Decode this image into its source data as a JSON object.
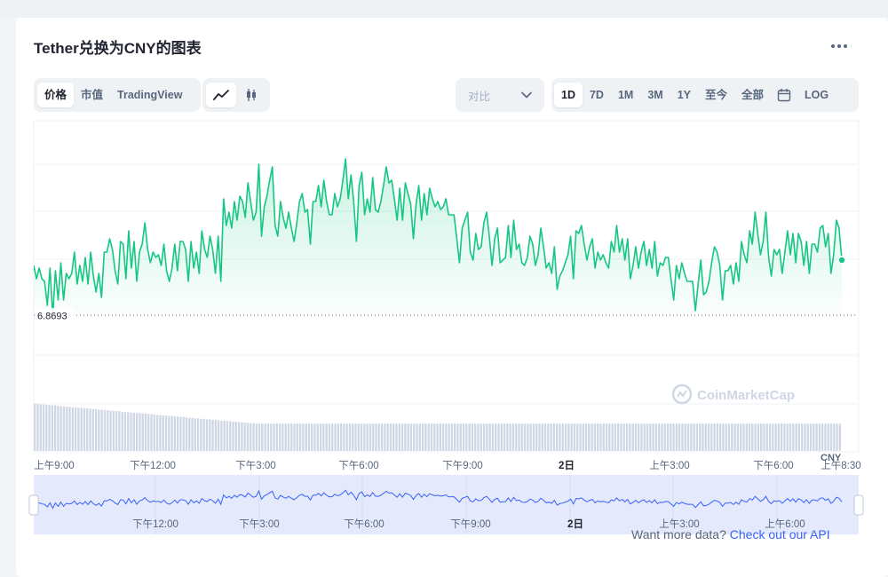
{
  "title": "Tether兑换为CNY的图表",
  "view_tabs": [
    "价格",
    "市值",
    "TradingView"
  ],
  "active_view": "价格",
  "chart_style_icons": [
    "line-chart-icon",
    "candlestick-icon"
  ],
  "compare": {
    "label": "对比",
    "icon": "chevron-down-icon"
  },
  "range_tabs": [
    "1D",
    "7D",
    "1M",
    "3M",
    "1Y",
    "至今",
    "全部"
  ],
  "active_range": "1D",
  "calendar_icon": "calendar-icon",
  "log_label": "LOG",
  "price_label": "6.8693",
  "currency_label": "CNY",
  "watermark": "CoinMarketCap",
  "x_ticks": [
    "上午9:00",
    "下午12:00",
    "下午3:00",
    "下午6:00",
    "下午9:00",
    "2日",
    "上午3:00",
    "下午6:00",
    "上午8:30"
  ],
  "mini_ticks": [
    "下午12:00",
    "下午3:00",
    "下午6:00",
    "下午9:00",
    "2日",
    "上午3:00",
    "上午6:00"
  ],
  "api_text": "Want more data?",
  "api_link": "Check out our API",
  "colors": {
    "up": "#16c784",
    "down": "#ea3943",
    "brand": "#3861fb",
    "navigator": "#3861fb"
  },
  "chart_data": {
    "type": "line",
    "baseline": 6.8693,
    "ylim": [
      6.862,
      6.896
    ],
    "grid": true,
    "price_shape": [
      0.47,
      0.42,
      0.46,
      0.42,
      0.41,
      0.32,
      0.46,
      0.28,
      0.45,
      0.34,
      0.48,
      0.34,
      0.44,
      0.42,
      0.44,
      0.52,
      0.4,
      0.47,
      0.41,
      0.5,
      0.4,
      0.52,
      0.43,
      0.37,
      0.44,
      0.35,
      0.52,
      0.52,
      0.57,
      0.53,
      0.45,
      0.4,
      0.56,
      0.55,
      0.42,
      0.6,
      0.46,
      0.56,
      0.41,
      0.52,
      0.55,
      0.63,
      0.53,
      0.48,
      0.52,
      0.5,
      0.51,
      0.47,
      0.55,
      0.45,
      0.41,
      0.46,
      0.55,
      0.45,
      0.56,
      0.56,
      0.53,
      0.41,
      0.56,
      0.46,
      0.52,
      0.44,
      0.6,
      0.53,
      0.5,
      0.58,
      0.53,
      0.44,
      0.58,
      0.41,
      0.72,
      0.62,
      0.67,
      0.61,
      0.71,
      0.64,
      0.73,
      0.71,
      0.65,
      0.78,
      0.71,
      0.64,
      0.67,
      0.85,
      0.58,
      0.69,
      0.73,
      0.79,
      0.84,
      0.62,
      0.58,
      0.71,
      0.65,
      0.61,
      0.67,
      0.61,
      0.56,
      0.63,
      0.71,
      0.74,
      0.67,
      0.68,
      0.55,
      0.71,
      0.71,
      0.77,
      0.69,
      0.79,
      0.71,
      0.66,
      0.66,
      0.74,
      0.69,
      0.72,
      0.79,
      0.87,
      0.72,
      0.81,
      0.71,
      0.56,
      0.77,
      0.82,
      0.66,
      0.72,
      0.67,
      0.8,
      0.68,
      0.67,
      0.71,
      0.77,
      0.84,
      0.78,
      0.79,
      0.72,
      0.64,
      0.76,
      0.64,
      0.78,
      0.74,
      0.7,
      0.57,
      0.7,
      0.77,
      0.64,
      0.74,
      0.66,
      0.76,
      0.72,
      0.69,
      0.71,
      0.68,
      0.69,
      0.72,
      0.66,
      0.66,
      0.66,
      0.57,
      0.48,
      0.61,
      0.64,
      0.67,
      0.52,
      0.49,
      0.59,
      0.53,
      0.54,
      0.63,
      0.67,
      0.58,
      0.47,
      0.57,
      0.61,
      0.48,
      0.49,
      0.5,
      0.62,
      0.5,
      0.64,
      0.53,
      0.55,
      0.48,
      0.47,
      0.5,
      0.58,
      0.55,
      0.47,
      0.51,
      0.61,
      0.54,
      0.46,
      0.48,
      0.44,
      0.54,
      0.38,
      0.43,
      0.45,
      0.48,
      0.51,
      0.58,
      0.42,
      0.6,
      0.59,
      0.62,
      0.55,
      0.49,
      0.54,
      0.57,
      0.46,
      0.52,
      0.49,
      0.51,
      0.48,
      0.46,
      0.56,
      0.52,
      0.62,
      0.52,
      0.57,
      0.49,
      0.57,
      0.42,
      0.47,
      0.54,
      0.46,
      0.52,
      0.56,
      0.47,
      0.53,
      0.46,
      0.56,
      0.43,
      0.48,
      0.47,
      0.5,
      0.5,
      0.42,
      0.34,
      0.47,
      0.42,
      0.48,
      0.44,
      0.41,
      0.41,
      0.41,
      0.3,
      0.4,
      0.49,
      0.36,
      0.37,
      0.41,
      0.48,
      0.54,
      0.52,
      0.47,
      0.34,
      0.45,
      0.45,
      0.47,
      0.4,
      0.48,
      0.41,
      0.56,
      0.51,
      0.48,
      0.6,
      0.55,
      0.67,
      0.59,
      0.51,
      0.56,
      0.67,
      0.5,
      0.43,
      0.53,
      0.51,
      0.53,
      0.44,
      0.52,
      0.6,
      0.51,
      0.59,
      0.48,
      0.59,
      0.56,
      0.47,
      0.56,
      0.44,
      0.55,
      0.55,
      0.52,
      0.61,
      0.62,
      0.54,
      0.59,
      0.44,
      0.51,
      0.64,
      0.61,
      0.49
    ],
    "volume_shape": [
      0.98,
      0.98,
      0.97,
      0.97,
      0.96,
      0.96,
      0.95,
      0.95,
      0.94,
      0.93,
      0.93,
      0.92,
      0.92,
      0.91,
      0.91,
      0.9,
      0.9,
      0.89,
      0.89,
      0.88,
      0.87,
      0.87,
      0.86,
      0.86,
      0.85,
      0.85,
      0.84,
      0.84,
      0.83,
      0.83,
      0.82,
      0.81,
      0.81,
      0.8,
      0.8,
      0.79,
      0.79,
      0.78,
      0.78,
      0.77,
      0.77,
      0.76,
      0.75,
      0.75,
      0.74,
      0.74,
      0.73,
      0.73,
      0.72,
      0.72,
      0.71,
      0.71,
      0.7,
      0.69,
      0.69,
      0.68,
      0.68,
      0.67,
      0.67,
      0.66,
      0.66,
      0.65,
      0.65,
      0.64,
      0.63,
      0.63,
      0.62,
      0.62,
      0.61,
      0.61,
      0.6,
      0.6,
      0.59,
      0.59,
      0.58,
      0.58,
      0.57,
      0.57,
      0.57,
      0.57,
      0.57,
      0.57,
      0.57,
      0.57,
      0.57,
      0.57,
      0.57,
      0.57,
      0.57,
      0.57,
      0.57,
      0.57,
      0.57,
      0.57,
      0.57,
      0.57,
      0.57,
      0.57,
      0.57,
      0.57,
      0.57,
      0.57,
      0.57,
      0.57,
      0.57,
      0.57,
      0.57,
      0.57,
      0.57,
      0.57,
      0.57,
      0.57,
      0.57,
      0.57,
      0.57,
      0.57,
      0.57,
      0.57,
      0.57,
      0.57,
      0.57,
      0.57,
      0.57,
      0.57,
      0.57,
      0.57,
      0.57,
      0.57,
      0.57,
      0.57,
      0.57,
      0.57,
      0.57,
      0.57,
      0.57,
      0.57,
      0.57,
      0.57,
      0.57,
      0.57,
      0.57,
      0.57,
      0.57,
      0.57,
      0.57,
      0.57,
      0.57,
      0.57,
      0.57,
      0.57,
      0.57,
      0.57,
      0.57,
      0.57,
      0.57,
      0.57,
      0.57,
      0.57,
      0.57,
      0.57,
      0.57,
      0.57,
      0.57,
      0.57,
      0.57,
      0.57,
      0.57,
      0.57,
      0.57,
      0.57,
      0.57,
      0.57,
      0.57,
      0.57,
      0.57,
      0.57,
      0.57,
      0.57,
      0.57,
      0.57,
      0.57,
      0.57,
      0.57,
      0.57,
      0.57,
      0.57,
      0.57,
      0.57,
      0.57,
      0.57,
      0.57,
      0.57,
      0.57,
      0.57,
      0.57,
      0.57,
      0.57,
      0.57,
      0.57,
      0.57,
      0.57,
      0.57,
      0.57,
      0.57,
      0.57,
      0.57,
      0.57,
      0.57,
      0.57,
      0.57,
      0.57,
      0.57,
      0.57,
      0.57,
      0.57,
      0.57,
      0.57,
      0.57,
      0.57,
      0.57,
      0.57,
      0.57,
      0.57,
      0.57,
      0.57,
      0.57,
      0.57,
      0.57,
      0.57,
      0.57,
      0.57,
      0.57,
      0.57,
      0.57,
      0.57,
      0.57,
      0.57,
      0.57,
      0.57,
      0.57,
      0.57,
      0.57,
      0.57,
      0.57,
      0.57,
      0.57,
      0.57,
      0.57,
      0.57,
      0.57,
      0.57,
      0.57,
      0.57,
      0.57,
      0.57,
      0.57,
      0.57,
      0.57,
      0.57,
      0.57,
      0.57,
      0.57,
      0.57,
      0.57,
      0.57,
      0.57,
      0.57,
      0.57,
      0.57,
      0.57,
      0.57,
      0.57,
      0.57,
      0.57,
      0.57,
      0.57,
      0.57
    ]
  }
}
